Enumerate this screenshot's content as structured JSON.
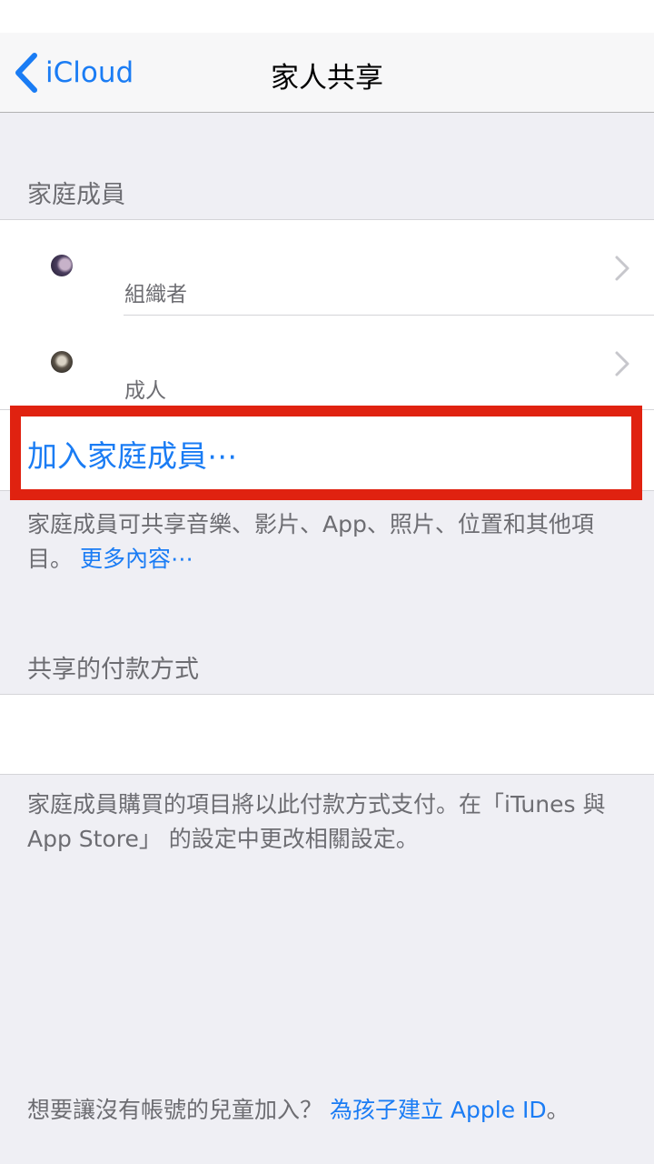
{
  "nav": {
    "back_label": "iCloud",
    "title": "家人共享"
  },
  "family_section": {
    "header": "家庭成員",
    "members": [
      {
        "role": "組織者",
        "avatar": "avatar-photo"
      },
      {
        "role": "成人",
        "avatar": "avatar-photo"
      }
    ],
    "add_label": "加入家庭成員⋯"
  },
  "family_footnote": {
    "text": "家庭成員可共享音樂、影片、App、照片、位置和其他項目。",
    "link": "更多內容⋯"
  },
  "payment_section": {
    "header": "共享的付款方式",
    "footnote": "家庭成員購買的項目將以此付款方式支付。在「iTunes 與 App Store」 的設定中更改相關設定。"
  },
  "child_account": {
    "text": "想要讓沒有帳號的兒童加入？",
    "link": "為孩子建立 Apple ID",
    "suffix": "。"
  },
  "colors": {
    "accent": "#1a7cf4",
    "highlight": "#e02210",
    "background": "#efeff4"
  }
}
